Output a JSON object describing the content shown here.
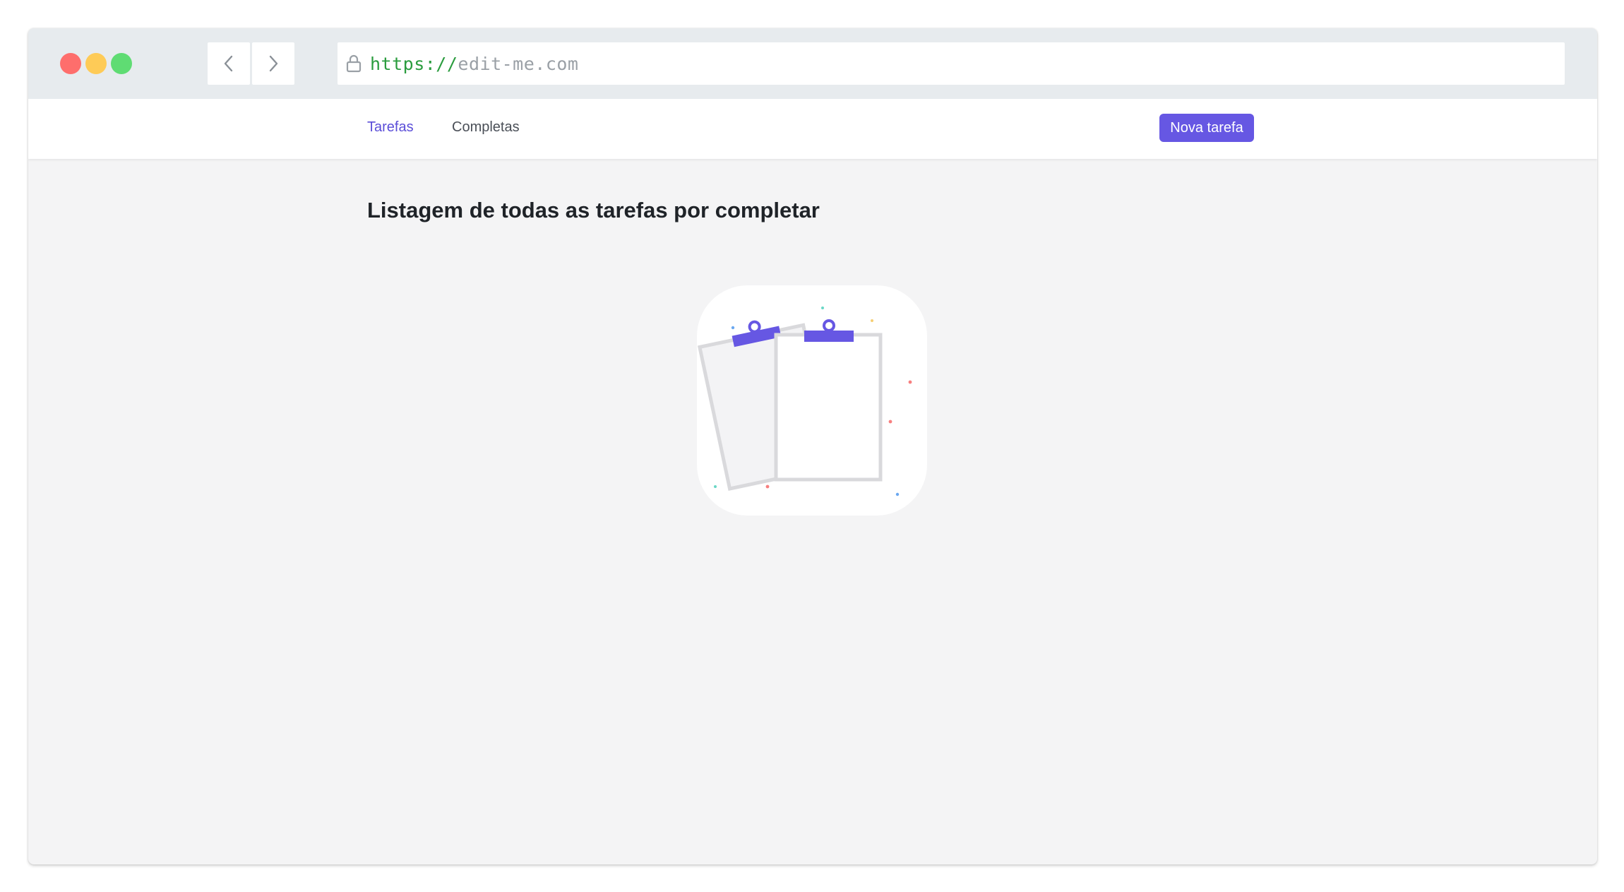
{
  "browser": {
    "url_scheme": "https://",
    "url_host": "edit-me.com",
    "traffic_lights": {
      "close": "#fe6e6c",
      "minimize": "#fecb57",
      "maximize": "#5fdc73"
    }
  },
  "nav": {
    "tabs": [
      {
        "label": "Tarefas",
        "active": true
      },
      {
        "label": "Completas",
        "active": false
      }
    ],
    "new_task_label": "Nova tarefa"
  },
  "main": {
    "heading": "Listagem de todas as tarefas por completar",
    "empty_state_icon": "clipboards-icon"
  },
  "colors": {
    "accent": "#6657e3",
    "page_background": "#f4f4f5",
    "chrome_background": "#e7ebee"
  }
}
